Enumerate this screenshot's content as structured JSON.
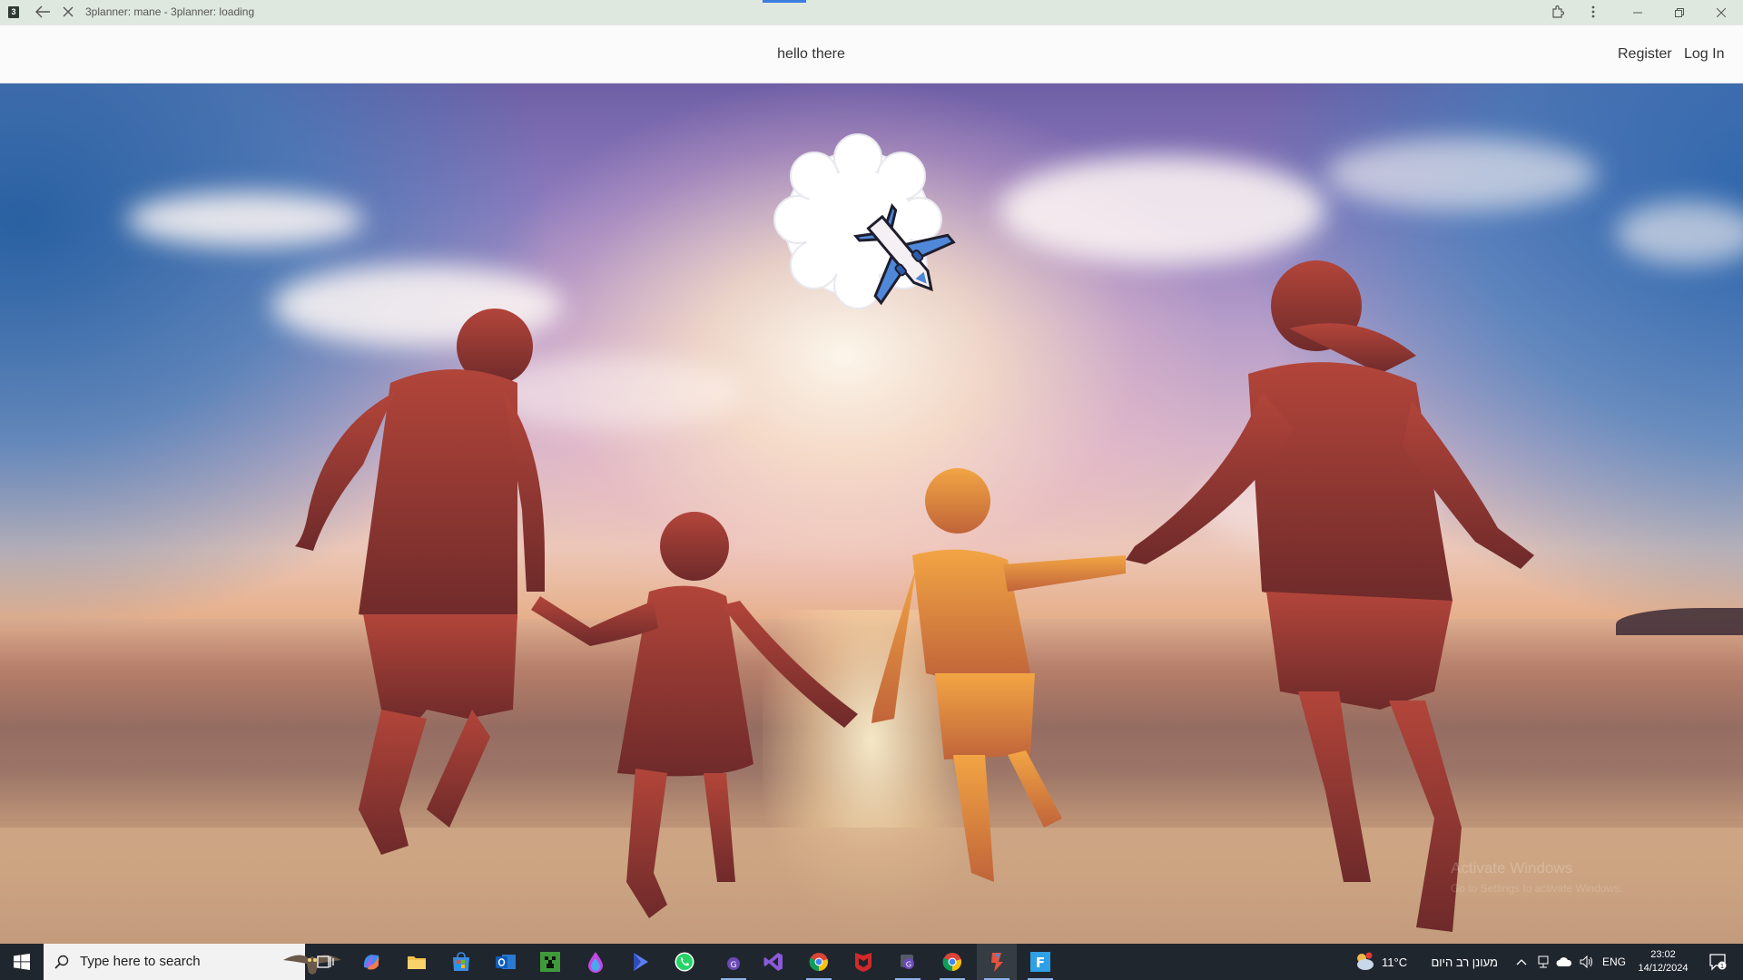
{
  "window": {
    "app_icon_letter": "3",
    "title": "3planner: mane - 3planner: loading",
    "back_icon": "back-arrow-icon",
    "stop_icon": "stop-loading-icon",
    "extensions_icon": "extensions-icon",
    "menu_icon": "more-vert-icon"
  },
  "navbar": {
    "brand": "hello there",
    "links": {
      "register": "Register",
      "login": "Log In"
    }
  },
  "hero": {
    "description_icon": "airplane-cloud-logo-icon",
    "watermark": {
      "title": "Activate Windows",
      "subtitle": "Go to Settings to activate Windows."
    }
  },
  "taskbar": {
    "search_placeholder": "Type here to search",
    "apps": [
      "task-view",
      "copilot",
      "file-explorer",
      "microsoft-store",
      "outlook",
      "minecraft",
      "drop-app",
      "video-app",
      "whatsapp",
      "app-g1",
      "visual-studio",
      "chrome",
      "mcafee",
      "app-g2",
      "chrome-2",
      "active-app",
      "active-app-2"
    ],
    "weather": {
      "temp": "11°C",
      "label": "מעונן רב היום"
    },
    "lang": "ENG",
    "clock": {
      "time": "23:02",
      "date": "14/12/2024"
    },
    "notification_count": "1"
  }
}
